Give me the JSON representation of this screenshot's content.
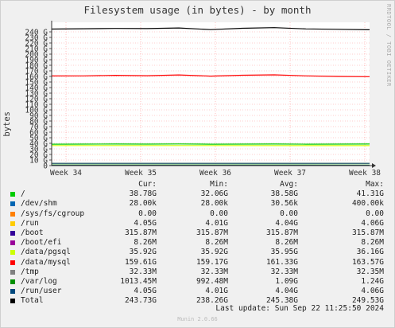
{
  "title": "Filesystem usage (in bytes) - by month",
  "side_label": "RRDTOOL / TOBI OETIKER",
  "footer": "Munin 2.0.66",
  "last_update": "Last update: Sun Sep 22 11:25:50 2024",
  "legend_headers": {
    "cur": "Cur:",
    "min": "Min:",
    "avg": "Avg:",
    "max": "Max:"
  },
  "legend": [
    {
      "name": "/",
      "color": "#00cc00",
      "cur": "38.78G",
      "min": "32.06G",
      "avg": "38.58G",
      "max": "41.31G"
    },
    {
      "name": "/dev/shm",
      "color": "#0066b3",
      "cur": "28.00k",
      "min": "28.00k",
      "avg": "30.56k",
      "max": "400.00k"
    },
    {
      "name": "/sys/fs/cgroup",
      "color": "#ff8000",
      "cur": "0.00",
      "min": "0.00",
      "avg": "0.00",
      "max": "0.00"
    },
    {
      "name": "/run",
      "color": "#ffcc00",
      "cur": "4.05G",
      "min": "4.01G",
      "avg": "4.04G",
      "max": "4.06G"
    },
    {
      "name": "/boot",
      "color": "#330099",
      "cur": "315.87M",
      "min": "315.87M",
      "avg": "315.87M",
      "max": "315.87M"
    },
    {
      "name": "/boot/efi",
      "color": "#990099",
      "cur": "8.26M",
      "min": "8.26M",
      "avg": "8.26M",
      "max": "8.26M"
    },
    {
      "name": "/data/pgsql",
      "color": "#ccff00",
      "cur": "35.92G",
      "min": "35.92G",
      "avg": "35.95G",
      "max": "36.16G"
    },
    {
      "name": "/data/mysql",
      "color": "#ff0000",
      "cur": "159.61G",
      "min": "159.17G",
      "avg": "161.33G",
      "max": "163.57G"
    },
    {
      "name": "/tmp",
      "color": "#808080",
      "cur": "32.33M",
      "min": "32.33M",
      "avg": "32.33M",
      "max": "32.35M"
    },
    {
      "name": "/var/log",
      "color": "#008f00",
      "cur": "1013.45M",
      "min": "992.48M",
      "avg": "1.09G",
      "max": "1.24G"
    },
    {
      "name": "/run/user",
      "color": "#00487d",
      "cur": "4.05G",
      "min": "4.01G",
      "avg": "4.04G",
      "max": "4.06G"
    },
    {
      "name": "Total",
      "color": "#000000",
      "cur": "243.73G",
      "min": "238.26G",
      "avg": "245.38G",
      "max": "249.53G"
    }
  ],
  "chart_data": {
    "type": "line",
    "title": "Filesystem usage (in bytes) - by month",
    "ylabel": "bytes",
    "ylim": [
      0,
      250
    ],
    "y_unit": "G",
    "y_ticks": [
      "0",
      "10 G",
      "20 G",
      "30 G",
      "40 G",
      "50 G",
      "60 G",
      "70 G",
      "80 G",
      "90 G",
      "100 G",
      "110 G",
      "120 G",
      "130 G",
      "140 G",
      "150 G",
      "160 G",
      "170 G",
      "180 G",
      "190 G",
      "200 G",
      "210 G",
      "220 G",
      "230 G",
      "240 G"
    ],
    "y_tick_values": [
      0,
      10,
      20,
      30,
      40,
      50,
      60,
      70,
      80,
      90,
      100,
      110,
      120,
      130,
      140,
      150,
      160,
      170,
      180,
      190,
      200,
      210,
      220,
      230,
      240
    ],
    "x_ticks": [
      "Week 34",
      "Week 35",
      "Week 36",
      "Week 37",
      "Week 38"
    ],
    "x_tick_positions": [
      0.045,
      0.28,
      0.515,
      0.75,
      0.985
    ],
    "grid": true,
    "series": [
      {
        "name": "Total",
        "color": "#000000",
        "x": [
          0,
          0.1,
          0.2,
          0.3,
          0.4,
          0.5,
          0.6,
          0.7,
          0.8,
          0.9,
          1.0
        ],
        "values": [
          245,
          245.6,
          246.2,
          245.9,
          247.0,
          244.0,
          246.5,
          247.6,
          245.3,
          244.6,
          243.7
        ]
      },
      {
        "name": "/data/mysql",
        "color": "#ff0000",
        "x": [
          0,
          0.1,
          0.2,
          0.3,
          0.4,
          0.5,
          0.6,
          0.7,
          0.8,
          0.9,
          1.0
        ],
        "values": [
          160.8,
          161.0,
          162.0,
          161.3,
          162.7,
          160.6,
          162.1,
          162.9,
          161.0,
          160.0,
          159.6
        ]
      },
      {
        "name": "/",
        "color": "#00cc00",
        "x": [
          0,
          0.1,
          0.2,
          0.3,
          0.4,
          0.5,
          0.6,
          0.7,
          0.8,
          0.9,
          1.0
        ],
        "values": [
          38.5,
          38.6,
          38.7,
          38.6,
          38.8,
          38.4,
          38.6,
          38.7,
          38.5,
          38.6,
          38.78
        ]
      },
      {
        "name": "/data/pgsql",
        "color": "#ccff00",
        "x": [
          0,
          0.5,
          1.0
        ],
        "values": [
          35.95,
          35.95,
          35.92
        ]
      },
      {
        "name": "/run",
        "color": "#ffcc00",
        "x": [
          0,
          0.5,
          1.0
        ],
        "values": [
          4.04,
          4.04,
          4.05
        ]
      },
      {
        "name": "/run/user",
        "color": "#00487d",
        "x": [
          0,
          0.5,
          1.0
        ],
        "values": [
          4.04,
          4.04,
          4.05
        ]
      },
      {
        "name": "/var/log",
        "color": "#008f00",
        "x": [
          0,
          0.5,
          1.0
        ],
        "values": [
          1.09,
          1.09,
          1.01
        ]
      },
      {
        "name": "/boot",
        "color": "#330099",
        "x": [
          0,
          1.0
        ],
        "values": [
          0.32,
          0.32
        ]
      }
    ]
  }
}
